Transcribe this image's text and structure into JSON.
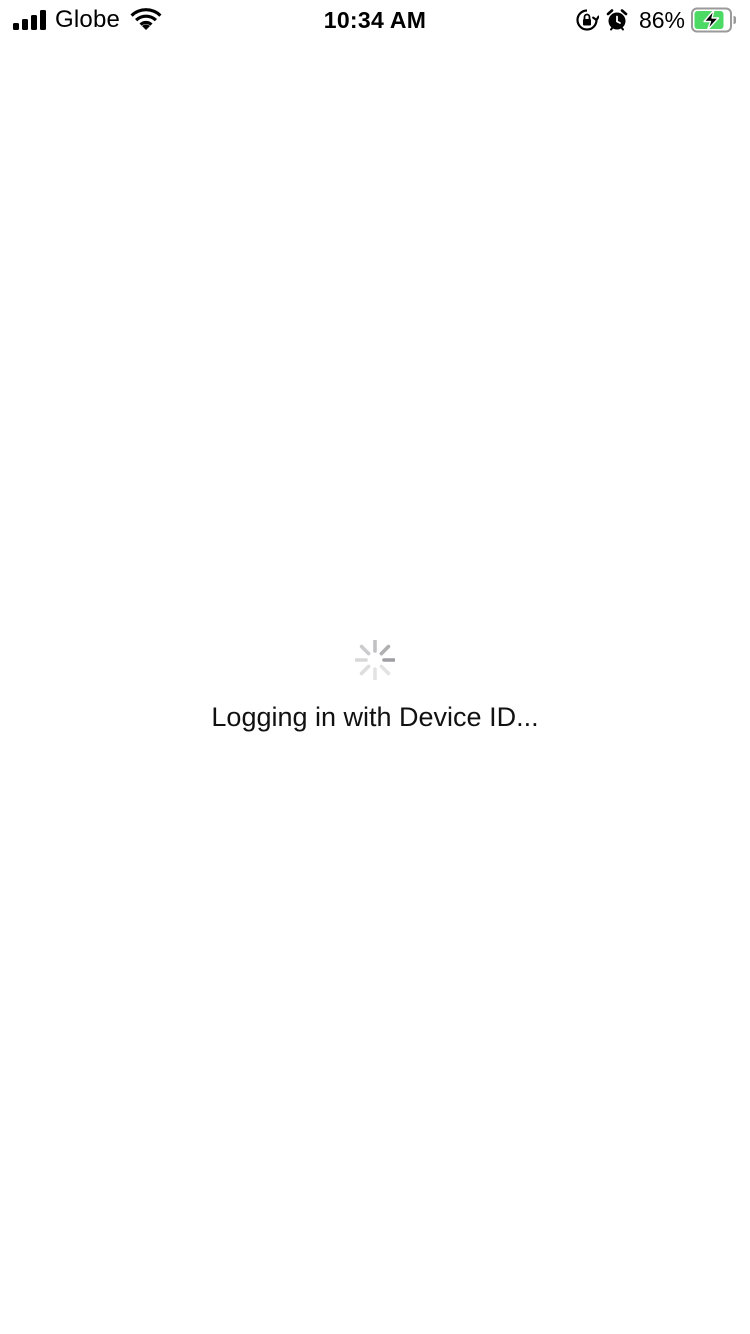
{
  "status_bar": {
    "carrier": "Globe",
    "time": "10:34 AM",
    "battery_percent": "86%",
    "signal_bars": 4,
    "icons": [
      "signal-icon",
      "wifi-icon",
      "rotation-lock-icon",
      "alarm-icon",
      "battery-charging-icon"
    ],
    "battery_fill_color": "#4cd964"
  },
  "main": {
    "loading_text": "Logging in with Device ID...",
    "spinner_icon": "activity-spinner-icon"
  }
}
